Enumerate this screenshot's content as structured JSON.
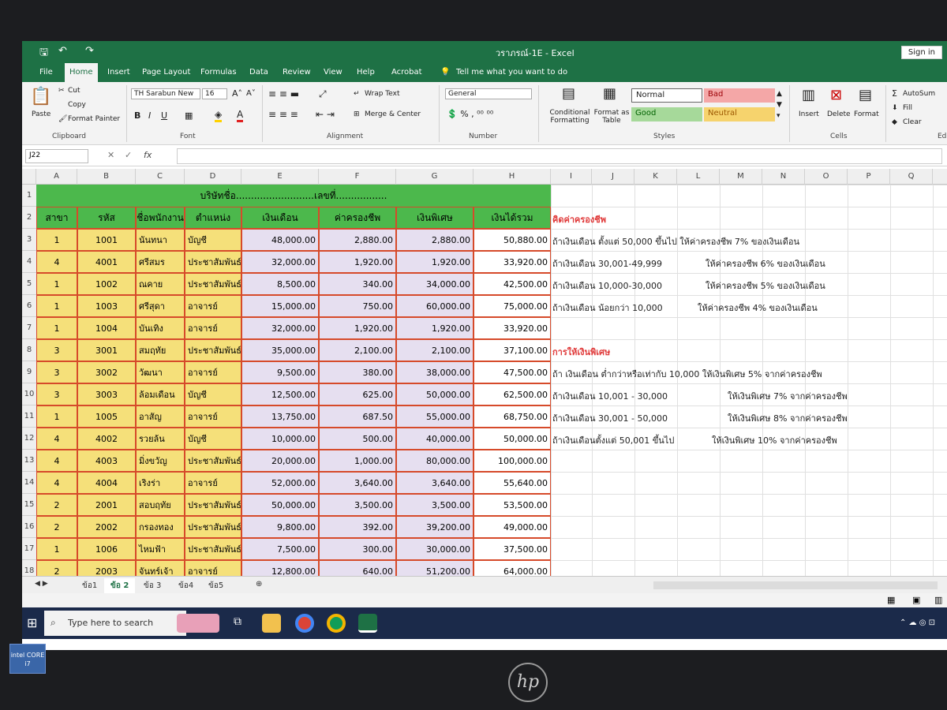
{
  "window": {
    "doc_title": "วราภรณ์-1E  -  Excel",
    "sign_in": "Sign in"
  },
  "tabs": [
    "File",
    "Home",
    "Insert",
    "Page Layout",
    "Formulas",
    "Data",
    "Review",
    "View",
    "Help",
    "Acrobat",
    "Tell me what you want to do"
  ],
  "ribbon": {
    "clipboard": {
      "paste": "Paste",
      "cut": "Cut",
      "copy": "Copy",
      "format_painter": "Format Painter",
      "label": "Clipboard"
    },
    "font": {
      "name": "TH Sarabun New",
      "size": "16",
      "label": "Font"
    },
    "alignment": {
      "wrap": "Wrap Text",
      "merge": "Merge & Center",
      "label": "Alignment"
    },
    "number": {
      "format": "General",
      "label": "Number"
    },
    "styles": {
      "conditional": "Conditional Formatting",
      "format_table": "Format as Table",
      "normal": "Normal",
      "bad": "Bad",
      "good": "Good",
      "neutral": "Neutral",
      "label": "Styles"
    },
    "cells": {
      "insert": "Insert",
      "delete": "Delete",
      "format": "Format",
      "label": "Cells"
    },
    "editing": {
      "autosum": "AutoSum",
      "fill": "Fill",
      "clear": "Clear",
      "label": "Ed"
    }
  },
  "formula_bar": {
    "name_box": "J22",
    "fx": "fx"
  },
  "columns": [
    "A",
    "B",
    "C",
    "D",
    "E",
    "F",
    "G",
    "H",
    "I",
    "J",
    "K",
    "L",
    "M",
    "N",
    "O",
    "P",
    "Q"
  ],
  "sheet": {
    "title_row": "บริษัทชื่อ..........................เลขที่.................",
    "headers": [
      "สาขา",
      "รหัส",
      "ชื่อพนักงาน",
      "ตำแหน่ง",
      "เงินเดือน",
      "ค่าครองชีพ",
      "เงินพิเศษ",
      "เงินได้รวม"
    ],
    "rows": [
      [
        "1",
        "1001",
        "นันทนา",
        "บัญชี",
        "48,000.00",
        "2,880.00",
        "2,880.00",
        "50,880.00"
      ],
      [
        "4",
        "4001",
        "ศรีสมร",
        "ประชาสัมพันธ์",
        "32,000.00",
        "1,920.00",
        "1,920.00",
        "33,920.00"
      ],
      [
        "1",
        "1002",
        "ณคาย",
        "ประชาสัมพันธ์",
        "8,500.00",
        "340.00",
        "34,000.00",
        "42,500.00"
      ],
      [
        "1",
        "1003",
        "ศรีสุดา",
        "อาจารย์",
        "15,000.00",
        "750.00",
        "60,000.00",
        "75,000.00"
      ],
      [
        "1",
        "1004",
        "บันเทิง",
        "อาจารย์",
        "32,000.00",
        "1,920.00",
        "1,920.00",
        "33,920.00"
      ],
      [
        "3",
        "3001",
        "สมฤทัย",
        "ประชาสัมพันธ์",
        "35,000.00",
        "2,100.00",
        "2,100.00",
        "37,100.00"
      ],
      [
        "3",
        "3002",
        "วัฒนา",
        "อาจารย์",
        "9,500.00",
        "380.00",
        "38,000.00",
        "47,500.00"
      ],
      [
        "3",
        "3003",
        "ล้อมเดือน",
        "บัญชี",
        "12,500.00",
        "625.00",
        "50,000.00",
        "62,500.00"
      ],
      [
        "1",
        "1005",
        "อาสัญ",
        "อาจารย์",
        "13,750.00",
        "687.50",
        "55,000.00",
        "68,750.00"
      ],
      [
        "4",
        "4002",
        "รวยล้น",
        "บัญชี",
        "10,000.00",
        "500.00",
        "40,000.00",
        "50,000.00"
      ],
      [
        "4",
        "4003",
        "มิ่งขวัญ",
        "ประชาสัมพันธ์",
        "20,000.00",
        "1,000.00",
        "80,000.00",
        "100,000.00"
      ],
      [
        "4",
        "4004",
        "เริงร่า",
        "อาจารย์",
        "52,000.00",
        "3,640.00",
        "3,640.00",
        "55,640.00"
      ],
      [
        "2",
        "2001",
        "สอบฤทัย",
        "ประชาสัมพันธ์",
        "50,000.00",
        "3,500.00",
        "3,500.00",
        "53,500.00"
      ],
      [
        "2",
        "2002",
        "กรองทอง",
        "ประชาสัมพันธ์",
        "9,800.00",
        "392.00",
        "39,200.00",
        "49,000.00"
      ],
      [
        "1",
        "1006",
        "ไหมฟ้า",
        "ประชาสัมพันธ์",
        "7,500.00",
        "300.00",
        "30,000.00",
        "37,500.00"
      ],
      [
        "2",
        "2003",
        "จันทร์เจ้า",
        "อาจารย์",
        "12,800.00",
        "640.00",
        "51,200.00",
        "64,000.00"
      ]
    ],
    "notes": {
      "cost_title": "คิดค่าครองชีพ",
      "cost_rules": [
        [
          "ถ้าเงินเดือน ตั้งแต่ 50,000 ขึ้นไป ให้ค่าครองชีพ  7%  ของเงินเดือน",
          ""
        ],
        [
          "ถ้าเงินเดือน 30,001-49,999",
          "ให้ค่าครองชีพ 6% ของเงินเดือน"
        ],
        [
          "ถ้าเงินเดือน 10,000-30,000",
          "ให้ค่าครองชีพ 5% ของเงินเดือน"
        ],
        [
          "ถ้าเงินเดือน น้อยกว่า 10,000",
          "ให้ค่าครองชีพ 4% ของเงินเดือน"
        ]
      ],
      "bonus_title": "การให้เงินพิเศษ",
      "bonus_rules": [
        [
          "ถ้า เงินเดือน ต่ำกว่าหรือเท่ากับ 10,000 ให้เงินพิเศษ 5% จากค่าครองชีพ",
          ""
        ],
        [
          "ถ้าเงินเดือน 10,001 - 30,000",
          "ให้เงินพิเศษ 7%  จากค่าครองชีพ"
        ],
        [
          "ถ้าเงินเดือน 30,001 - 50,000",
          "ให้เงินพิเศษ 8%   จากค่าครองชีพ"
        ],
        [
          "ถ้าเงินเดือนตั้งแต่ 50,001 ขึ้นไป",
          "ให้เงินพิเศษ 10%    จากค่าครองชีพ"
        ]
      ]
    }
  },
  "sheet_tabs": [
    "ข้อ1",
    "ข้อ 2",
    "ข้อ 3",
    "ข้อ4",
    "ข้อ5"
  ],
  "taskbar": {
    "search": "Type here to search"
  },
  "laptop": {
    "intel": "intel CORE i7",
    "brand": "hp"
  }
}
